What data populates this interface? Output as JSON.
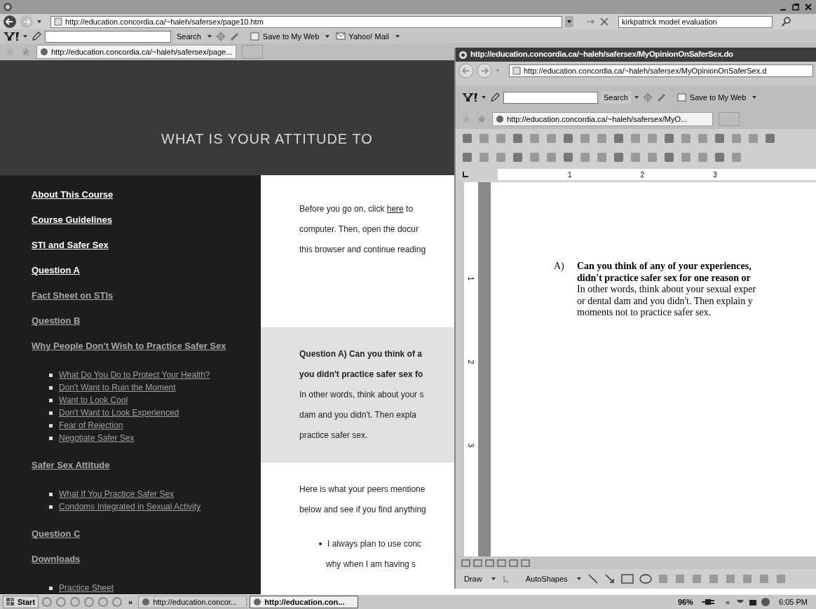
{
  "browser": {
    "address": "http://education.concordia.ca/~haleh/safersex/page10.htm",
    "search_query": "kirkpatrick model evaluation",
    "toolbar": {
      "search_button": "Search",
      "save": "Save to My Web",
      "mail": "Yahoo! Mail"
    },
    "tab": "http://education.concordia.ca/~haleh/safersex/page..."
  },
  "page": {
    "banner": "WHAT IS YOUR ATTITUDE TO",
    "sidebar": [
      {
        "label": "About This Course",
        "dimmed": false
      },
      {
        "label": "Course Guidelines",
        "dimmed": false
      },
      {
        "label": "STI and Safer Sex",
        "dimmed": false
      },
      {
        "label": "Question A",
        "dimmed": false
      },
      {
        "label": "Fact Sheet on STIs",
        "dimmed": true
      },
      {
        "label": "Question B",
        "dimmed": true
      },
      {
        "label": "Why People Don't Wish to Practice Safer Sex",
        "dimmed": true,
        "children": [
          {
            "label": "What Do You Do to Protect Your Health?"
          },
          {
            "label": "Don't Want to Ruin the Moment"
          },
          {
            "label": "Want to Look Cool"
          },
          {
            "label": "Don't Want to Look Experienced"
          },
          {
            "label": "Fear of Rejection"
          },
          {
            "label": "Negotiate Safer Sex"
          }
        ]
      },
      {
        "label": "Safer Sex Attitude",
        "dimmed": true,
        "children": [
          {
            "label": "What If You Practice Safer Sex"
          },
          {
            "label": "Condoms Integrated in Sexual Activity"
          }
        ]
      },
      {
        "label": "Question C",
        "dimmed": true
      },
      {
        "label": "Downloads",
        "dimmed": true,
        "children": [
          {
            "label": "Practice Sheet"
          }
        ]
      }
    ],
    "intro": {
      "before": "Before you go on, click",
      "link": "here",
      "after": "to",
      "lines": [
        "computer.  Then, open the docur",
        "this browser and continue reading"
      ]
    },
    "question_lines": [
      {
        "text": "Question A) Can you think of a",
        "bold": true
      },
      {
        "text": "you didn't practice safer sex fo",
        "bold": true
      },
      {
        "text": "In other words, think about your s",
        "bold": false
      },
      {
        "text": "dam and you didn't.  Then expla",
        "bold": false
      },
      {
        "text": "practice safer sex.",
        "bold": false
      }
    ],
    "peers_lines": [
      "Here is what your peers mentione",
      "below and see if you find anything"
    ],
    "bullet_lines": [
      "I always plan to use conc",
      "why when I am having s"
    ]
  },
  "word_window": {
    "title": "http://education.concordia.ca/~haleh/safersex/MyOpinionOnSaferSex.do",
    "address": "http://education.concordia.ca/~haleh/safersex/MyOpinionOnSaferSex.d",
    "toolbar": {
      "search_button": "Search",
      "save": "Save to My Web"
    },
    "tab": "http://education.concordia.ca/~haleh/safersex/MyO...",
    "ruler_marks": [
      "1",
      "2",
      "3"
    ],
    "vertical_ruler_marks": [
      "1",
      "2",
      "3"
    ],
    "doc": {
      "marker": "A)",
      "bold_lines": [
        "Can you think of any of your experiences,",
        "didn't practice safer sex for one reason or"
      ],
      "lines": [
        "In other words, think about your sexual exper",
        "or dental dam and you didn't.  Then explain y",
        "moments not to practice safer sex."
      ]
    },
    "draw_toolbar": {
      "draw": "Draw",
      "autoshapes": "AutoShapes"
    }
  },
  "taskbar": {
    "start": "Start",
    "more": "»",
    "tasks": [
      {
        "label": "http://education.concor...",
        "selected": false
      },
      {
        "label": "http://education.con...",
        "selected": true
      }
    ],
    "tray": {
      "zoom": "96%",
      "expand": "«",
      "clock": "6:05 PM"
    }
  }
}
